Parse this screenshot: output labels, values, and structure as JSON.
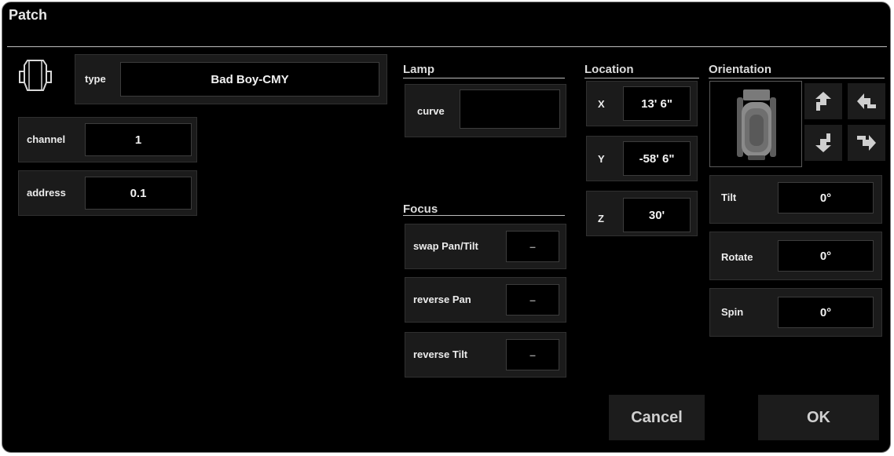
{
  "dialog": {
    "title": "Patch"
  },
  "fixture": {
    "icon": "fixture-head-icon",
    "type_label": "type",
    "type_value": "Bad Boy-CMY",
    "channel_label": "channel",
    "channel_value": "1",
    "address_label": "address",
    "address_value": "0.1"
  },
  "lamp": {
    "title": "Lamp",
    "curve_label": "curve",
    "curve_value": ""
  },
  "focus": {
    "title": "Focus",
    "swap_label": "swap Pan/Tilt",
    "swap_value": "–",
    "reverse_pan_label": "reverse Pan",
    "reverse_pan_value": "–",
    "reverse_tilt_label": "reverse Tilt",
    "reverse_tilt_value": "–"
  },
  "location": {
    "title": "Location",
    "x_label": "X",
    "x_value": "13' 6\"",
    "y_label": "Y",
    "y_value": "-58' 6\"",
    "z_label": "Z",
    "z_value": "30'"
  },
  "orientation": {
    "title": "Orientation",
    "preview_icon": "fixture-preview-icon",
    "rotate_buttons": [
      "rotate-up-icon",
      "rotate-right-icon",
      "rotate-down-icon",
      "rotate-left-icon"
    ],
    "tilt_label": "Tilt",
    "tilt_value": "0°",
    "rotate_label": "Rotate",
    "rotate_value": "0°",
    "spin_label": "Spin",
    "spin_value": "0°"
  },
  "buttons": {
    "cancel": "Cancel",
    "ok": "OK"
  },
  "colors": {
    "background": "#000000",
    "panel": "#1b1b1b",
    "text": "#ececec"
  }
}
